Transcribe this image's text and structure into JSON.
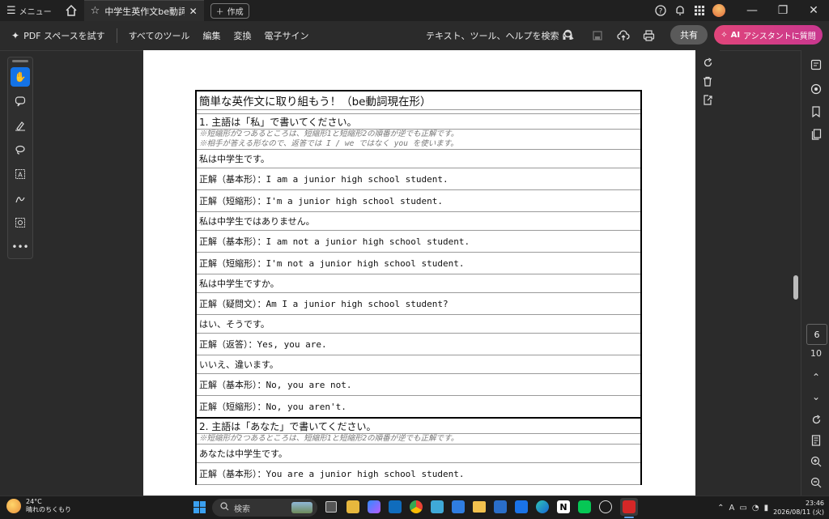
{
  "titlebar": {
    "menu_label": "メニュー",
    "tab_title": "中学生英作文be動詞...",
    "new_tab_label": "作成"
  },
  "toolbar": {
    "pdf_space_label": "PDF スペースを試す",
    "all_tools": "すべてのツール",
    "edit": "編集",
    "convert": "変換",
    "e_sign": "電子サイン",
    "search_label": "テキスト、ツール、ヘルプを検索",
    "share_label": "共有",
    "ai_badge": "AI",
    "ai_label": "アシスタントに質問"
  },
  "document": {
    "title": "簡単な英作文に取り組もう！（be動詞現在形）",
    "section1": {
      "heading": "1. 主語は「私」で書いてください。",
      "note1": "※短縮形が2つあるところは、短縮形1と短縮形2の順番が逆でも正解です。",
      "note2": "※相手が答える形なので、返答では I / we ではなく you を使います。",
      "rows": [
        {
          "kind": "jp",
          "text": "私は中学生です。"
        },
        {
          "kind": "ans",
          "text": "正解（基本形）：I am a junior high school student."
        },
        {
          "kind": "ans",
          "text": "正解（短縮形）：I'm a junior high school student."
        },
        {
          "kind": "jp",
          "text": "私は中学生ではありません。"
        },
        {
          "kind": "ans",
          "text": "正解（基本形）：I am not a junior high school student."
        },
        {
          "kind": "ans",
          "text": "正解（短縮形）：I'm not a junior high school student."
        },
        {
          "kind": "jp",
          "text": "私は中学生ですか。"
        },
        {
          "kind": "ans",
          "text": "正解（疑問文）：Am I a junior high school student?"
        },
        {
          "kind": "jp",
          "text": "はい、そうです。"
        },
        {
          "kind": "ans",
          "text": "正解（返答）：Yes, you are."
        },
        {
          "kind": "jp",
          "text": "いいえ、違います。"
        },
        {
          "kind": "ans",
          "text": "正解（基本形）：No, you are not."
        },
        {
          "kind": "ans",
          "text": "正解（短縮形）：No, you aren't."
        }
      ]
    },
    "section2": {
      "heading": "2. 主語は「あなた」で書いてください。",
      "note1": "※短縮形が2つあるところは、短縮形1と短縮形2の順番が逆でも正解です。",
      "row1": "あなたは中学生です。",
      "row2": "正解（基本形）：You are a junior high school student."
    }
  },
  "pagenav": {
    "current_page": "6",
    "total_pages": "10"
  },
  "taskbar": {
    "temperature": "24°C",
    "weather": "晴れのちくもり",
    "search_placeholder": "検索",
    "time": "23:46",
    "date": "2026/08/11 (火)",
    "ime": "A"
  },
  "colors": {
    "accent": "#1473e6",
    "ai_gradient_start": "#e0457a",
    "ai_gradient_end": "#c9378f"
  }
}
